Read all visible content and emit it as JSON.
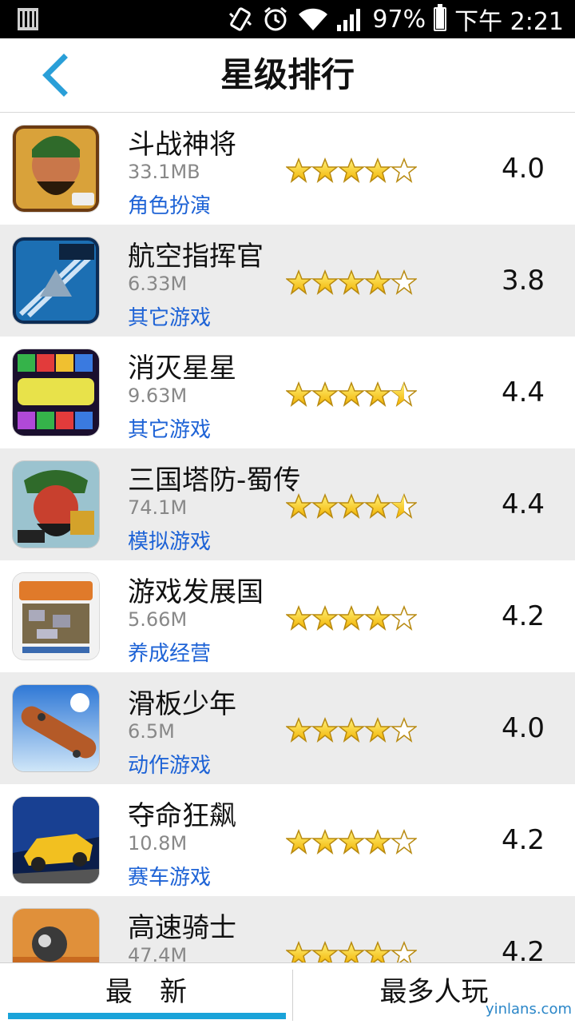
{
  "status_bar": {
    "battery": "97%",
    "time": "下午 2:21",
    "battery_level": 0.97
  },
  "header": {
    "title": "星级排行"
  },
  "apps": [
    {
      "name": "斗战神将",
      "size": "33.1MB",
      "category": "角色扮演",
      "rating": "4.0",
      "stars": 4.0
    },
    {
      "name": "航空指挥官",
      "size": "6.33M",
      "category": "其它游戏",
      "rating": "3.8",
      "stars": 4.0
    },
    {
      "name": "消灭星星",
      "size": "9.63M",
      "category": "其它游戏",
      "rating": "4.4",
      "stars": 4.5
    },
    {
      "name": "三国塔防-蜀传",
      "size": "74.1M",
      "category": "模拟游戏",
      "rating": "4.4",
      "stars": 4.5
    },
    {
      "name": "游戏发展国",
      "size": "5.66M",
      "category": "养成经营",
      "rating": "4.2",
      "stars": 4.0
    },
    {
      "name": "滑板少年",
      "size": "6.5M",
      "category": "动作游戏",
      "rating": "4.0",
      "stars": 4.0
    },
    {
      "name": "夺命狂飙",
      "size": "10.8M",
      "category": "赛车游戏",
      "rating": "4.2",
      "stars": 4.0
    },
    {
      "name": "高速骑士",
      "size": "47.4M",
      "category": "",
      "rating": "4.2",
      "stars": 4.0
    }
  ],
  "tabs": {
    "latest": "最　新",
    "most_played": "最多人玩"
  },
  "watermark": "yinlans.com",
  "colors": {
    "accent": "#1aa3d9",
    "category_link": "#1e63d6",
    "back_arrow": "#2a9fd8"
  }
}
